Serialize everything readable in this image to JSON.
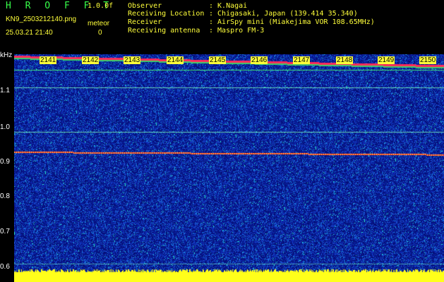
{
  "app": {
    "title": "H R O F F T",
    "version": "1.0.0f",
    "filename": "KN9_2503212140.png",
    "datetime": "25.03.21 21:40",
    "meteor_label": "meteor",
    "meteor_count": "0"
  },
  "info": {
    "observer_label": "Observer",
    "observer_value": ": K.Nagai",
    "location_label": "Receiving Location",
    "location_value": ": Chigasaki, Japan (139.414 35.340)",
    "receiver_label": "Receiver",
    "receiver_value": ": AirSpy mini (Miakejima VOR 108.65MHz)",
    "antenna_label": "Receiving antenna",
    "antenna_value": ": Maspro FM-3"
  },
  "axis": {
    "unit": "kHz",
    "ticks": [
      "1.1",
      "1.0",
      "0.9",
      "0.8",
      "0.7",
      "0.6"
    ]
  },
  "minute_labels": [
    "2141",
    "2142",
    "2143",
    "2144",
    "2145",
    "2146",
    "2147",
    "2148",
    "2149",
    "2150"
  ],
  "colors": {
    "background": "#000000",
    "noise_base": "#0a1a9c",
    "accent_yellow": "#ffff3a",
    "accent_green": "#37ff4a",
    "signal_red": "#ff2020"
  }
}
